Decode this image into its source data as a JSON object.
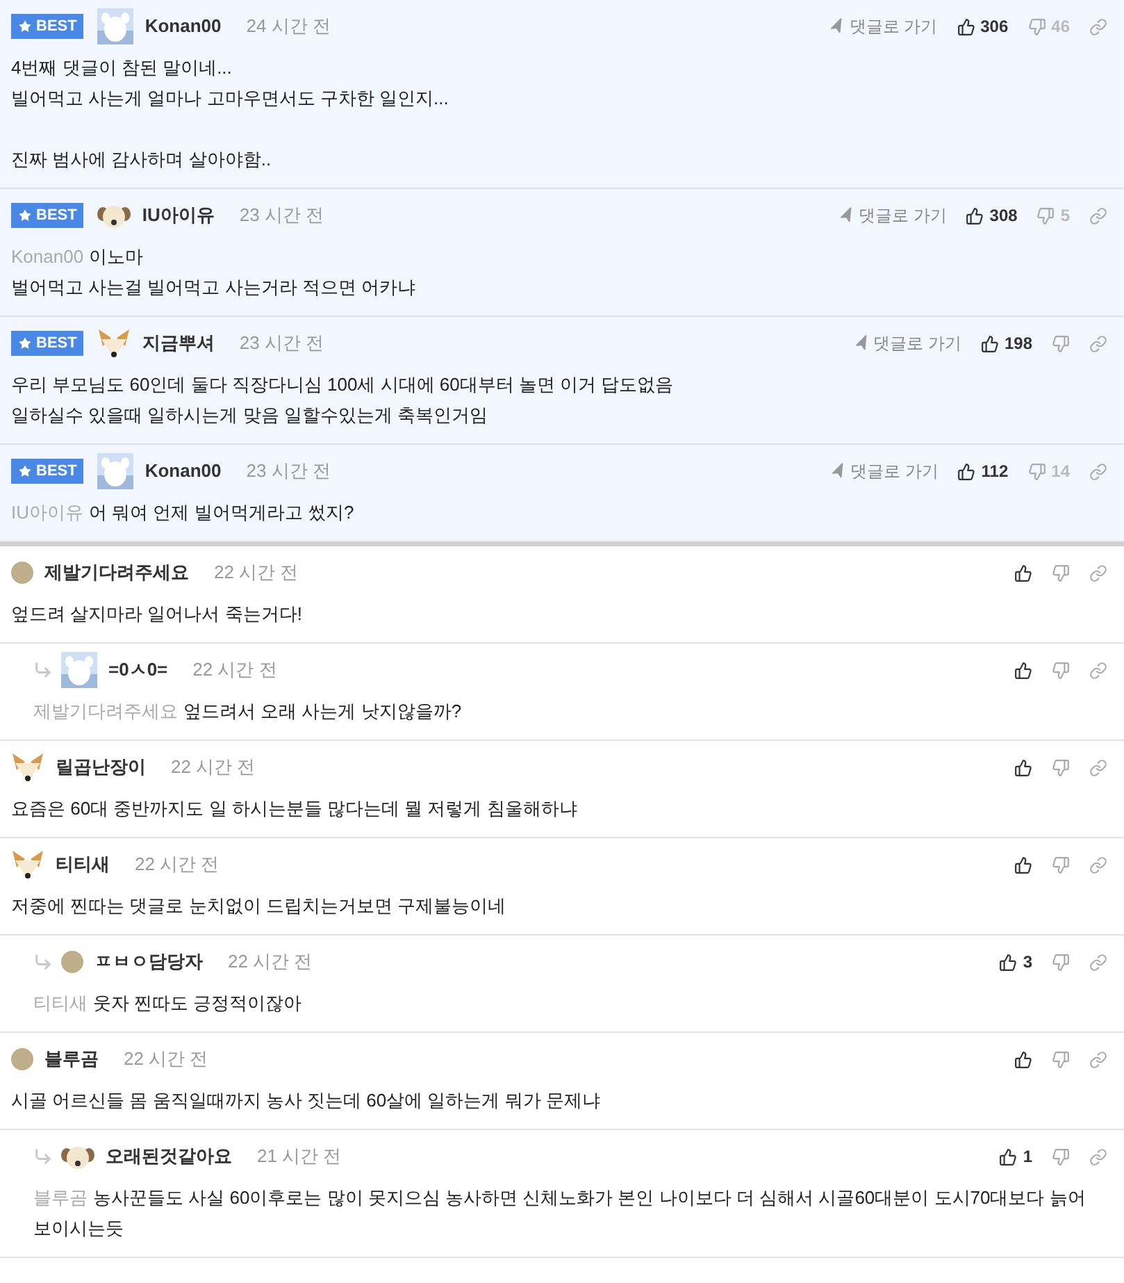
{
  "comments": [
    {
      "best": true,
      "badge": "BEST",
      "reply": false,
      "author": "Konan00",
      "time": "24 시간 전",
      "goto": "댓글로 가기",
      "likes": "306",
      "dislikes": "46",
      "text": "4번째 댓글이 참된 말이네...\n빌어먹고 사는게 얼마나 고마우면서도 구차한 일인지...\n\n진짜 범사에 감사하며 살아야함.."
    },
    {
      "best": true,
      "badge": "BEST",
      "reply": false,
      "avatar": {
        "kind": "dog"
      },
      "author": "IU아이유",
      "time": "23 시간 전",
      "goto": "댓글로 가기",
      "likes": "308",
      "dislikes": "5",
      "mention": "Konan00",
      "text": "이노마\n벌어먹고 사는걸 빌어먹고 사는거라 적으면 어카냐"
    },
    {
      "best": true,
      "badge": "BEST",
      "reply": false,
      "avatar": {
        "kind": "fox"
      },
      "author": "지금뿌셔",
      "time": "23 시간 전",
      "goto": "댓글로 가기",
      "likes": "198",
      "text": "우리 부모님도 60인데 둘다 직장다니심 100세 시대에 60대부터 놀면 이거 답도없음\n일하실수 있을때 일하시는게 맞음 일할수있는게 축복인거임"
    },
    {
      "best": true,
      "badge": "BEST",
      "reply": false,
      "author": "Konan00",
      "time": "23 시간 전",
      "goto": "댓글로 가기",
      "likes": "112",
      "dislikes": "14",
      "mention": "IU아이유",
      "text": "어 뭐여 언제 빌어먹게라고 썼지?"
    },
    {
      "best": false,
      "reply": false,
      "avatar": {
        "kind": "dot"
      },
      "author": "제발기다려주세요",
      "time": "22 시간 전",
      "text": "엎드려 살지마라 일어나서 죽는거다!"
    },
    {
      "best": false,
      "reply": true,
      "author": "=0ㅅ0=",
      "time": "22 시간 전",
      "mention": "제발기다려주세요",
      "text": "엎드려서 오래 사는게 낫지않을까?"
    },
    {
      "best": false,
      "reply": false,
      "avatar": {
        "kind": "fox"
      },
      "author": "릴곱난장이",
      "time": "22 시간 전",
      "text": "요즘은 60대 중반까지도 일 하시는분들 많다는데 뭘 저렇게 침울해하냐"
    },
    {
      "best": false,
      "reply": false,
      "avatar": {
        "kind": "fox"
      },
      "author": "티티새",
      "time": "22 시간 전",
      "text": "저중에 찐따는 댓글로 눈치없이 드립치는거보면 구제불능이네"
    },
    {
      "best": false,
      "reply": true,
      "avatar": {
        "kind": "dot"
      },
      "author": "ㅍㅂㅇ담당자",
      "time": "22 시간 전",
      "likes": "3",
      "mention": "티티새",
      "text": "웃자 찐따도 긍정적이잖아"
    },
    {
      "best": false,
      "reply": false,
      "avatar": {
        "kind": "dot"
      },
      "author": "블루곰",
      "time": "22 시간 전",
      "text": "시골 어르신들 몸 움직일때까지 농사 짓는데 60살에 일하는게 뭐가 문제냐"
    },
    {
      "best": false,
      "reply": true,
      "avatar": {
        "kind": "dog"
      },
      "author": "오래된것같아요",
      "time": "21 시간 전",
      "likes": "1",
      "mention": "블루곰",
      "text": "농사꾼들도 사실 60이후로는 많이 못지으심 농사하면 신체노화가 본인 나이보다 더 심해서 시골60대분이 도시70대보다 늙어 보이시는듯"
    }
  ]
}
